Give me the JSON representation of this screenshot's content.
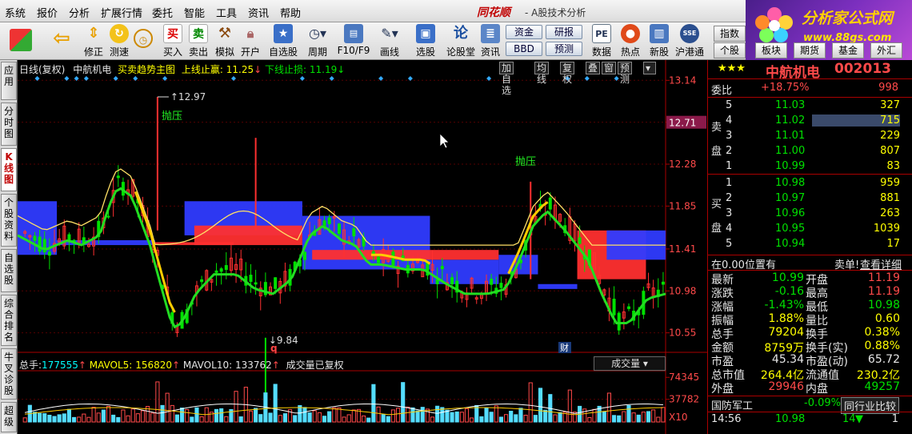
{
  "menu": [
    "系统",
    "报价",
    "分析",
    "扩展行情",
    "委托",
    "智能",
    "工具",
    "资讯",
    "帮助"
  ],
  "brand": "同花顺",
  "brand_sub": "- A股技术分析",
  "logo": {
    "title": "分析家公式网",
    "url": "www.88gs.com"
  },
  "toolbar": [
    {
      "label": "修正",
      "icon": "up-down-arrows-icon"
    },
    {
      "label": "测速",
      "icon": "speed-icon"
    },
    {
      "label": "买入",
      "icon": "buy-icon",
      "glyph": "买"
    },
    {
      "label": "卖出",
      "icon": "sell-icon",
      "glyph": "卖"
    },
    {
      "label": "模拟",
      "icon": "hammer-icon"
    },
    {
      "label": "开户",
      "icon": "lock-icon"
    },
    {
      "label": "自选股",
      "icon": "star-icon"
    },
    {
      "label": "周期",
      "icon": "clock-icon"
    },
    {
      "label": "F10/F9",
      "icon": "document-icon"
    },
    {
      "label": "画线",
      "icon": "pen-icon"
    },
    {
      "label": "选股",
      "icon": "monitor-icon"
    },
    {
      "label": "论股堂",
      "icon": "discuss-icon"
    },
    {
      "label": "资讯",
      "icon": "news-icon"
    },
    {
      "label": "数据",
      "icon": "pe-icon",
      "glyph": "PE"
    },
    {
      "label": "热点",
      "icon": "hot-icon"
    },
    {
      "label": "新股",
      "icon": "new-stock-icon"
    },
    {
      "label": "沪港通",
      "icon": "sse-hkex-icon"
    }
  ],
  "toolbar_buttons": [
    "资金",
    "研报",
    "BBD",
    "预测"
  ],
  "right_tabs": [
    "指数",
    "个股",
    "板块",
    "期货",
    "基金",
    "外汇"
  ],
  "left_tabs": [
    {
      "label": "应用",
      "active": false
    },
    {
      "label": "分时图",
      "active": false
    },
    {
      "label": "K线图",
      "active": true
    },
    {
      "label": "个股资料",
      "active": false
    },
    {
      "label": "自选股",
      "active": false
    },
    {
      "label": "综合排名",
      "active": false
    },
    {
      "label": "牛叉诊股",
      "active": false
    },
    {
      "label": "超级",
      "active": false
    }
  ],
  "chart_header": {
    "period": "日线(复权)",
    "name": "中航机电",
    "indicator": "买卖趋势主图",
    "upper_label": "上线止赢:",
    "upper_value": "11.25",
    "lower_label": "下线止损:",
    "lower_value": "11.19",
    "buttons": [
      "加自选",
      "均线",
      "复权",
      "叠",
      "窗",
      "预测"
    ]
  },
  "price_axis": [
    "13.14",
    "12.71",
    "12.28",
    "11.85",
    "11.41",
    "10.98",
    "10.55"
  ],
  "current_price_tag": "12.71",
  "annotations": {
    "high": "12.97",
    "low": "9.84",
    "pressure1": "抛压",
    "pressure2": "抛压",
    "q_marker": "q",
    "cai_marker": "财"
  },
  "volume_header": {
    "total_label": "总手:",
    "total": "177555",
    "mavol5_label": "MAVOL5:",
    "mavol5": "156820",
    "mavol10_label": "MAVOL10:",
    "mavol10": "133762",
    "note": "成交量已复权",
    "dropdown": "成交量"
  },
  "volume_axis": [
    "74345",
    "37782",
    "X10"
  ],
  "quote": {
    "stars": "★★★",
    "name": "中航机电",
    "code": "002013",
    "weibi_label": "委比",
    "weibi": "+18.75%",
    "weicha": "998",
    "sell_label": "卖盘",
    "buy_label": "买盘",
    "asks": [
      {
        "lvl": "5",
        "price": "11.03",
        "vol": "327"
      },
      {
        "lvl": "4",
        "price": "11.02",
        "vol": "715"
      },
      {
        "lvl": "3",
        "price": "11.01",
        "vol": "229"
      },
      {
        "lvl": "2",
        "price": "11.00",
        "vol": "807"
      },
      {
        "lvl": "1",
        "price": "10.99",
        "vol": "83"
      }
    ],
    "bids": [
      {
        "lvl": "1",
        "price": "10.98",
        "vol": "959"
      },
      {
        "lvl": "2",
        "price": "10.97",
        "vol": "881"
      },
      {
        "lvl": "3",
        "price": "10.96",
        "vol": "263"
      },
      {
        "lvl": "4",
        "price": "10.95",
        "vol": "1039"
      },
      {
        "lvl": "5",
        "price": "10.94",
        "vol": "17"
      }
    ],
    "position_note": "在0.00位置有",
    "sell_single": "卖单!",
    "detail_link": "查看详细",
    "stats": [
      {
        "l1": "最新",
        "v1": "10.99",
        "c1": "green",
        "l2": "开盘",
        "v2": "11.19",
        "c2": "red"
      },
      {
        "l1": "涨跌",
        "v1": "-0.16",
        "c1": "green",
        "l2": "最高",
        "v2": "11.19",
        "c2": "red"
      },
      {
        "l1": "涨幅",
        "v1": "-1.43%",
        "c1": "green",
        "l2": "最低",
        "v2": "10.98",
        "c2": "green"
      },
      {
        "l1": "振幅",
        "v1": "1.88%",
        "c1": "yellow",
        "l2": "量比",
        "v2": "0.60",
        "c2": "yellow"
      },
      {
        "l1": "总手",
        "v1": "79204",
        "c1": "yellow",
        "l2": "换手",
        "v2": "0.38%",
        "c2": "yellow"
      },
      {
        "l1": "金额",
        "v1": "8759万",
        "c1": "yellow",
        "l2": "换手(实)",
        "v2": "0.88%",
        "c2": "yellow"
      },
      {
        "l1": "市盈",
        "v1": "45.34",
        "c1": "white",
        "l2": "市盈(动)",
        "v2": "65.72",
        "c2": "white"
      },
      {
        "l1": "总市值",
        "v1": "264.4亿",
        "c1": "yellow",
        "l2": "流通值",
        "v2": "230.2亿",
        "c2": "yellow"
      },
      {
        "l1": "外盘",
        "v1": "29946",
        "c1": "red",
        "l2": "内盘",
        "v2": "49257",
        "c2": "green"
      }
    ],
    "sector": "国防军工",
    "sector_change": "-0.09%",
    "compare_btn": "同行业比较",
    "tick_time": "14:56",
    "tick_price": "10.98",
    "tick_vol": "14",
    "tick_count": "1"
  },
  "colors": {
    "up": "#ff3030",
    "down": "#00e000",
    "blue_band": "#2f3bff",
    "red_band": "#ff2f2f",
    "yellow": "#ffcc00",
    "green_line": "#22dd22",
    "axis_red": "#aa0000",
    "vol_bar": "#55ddff"
  },
  "chart_data": {
    "type": "candlestick",
    "price_ticks": [
      13.14,
      12.71,
      12.28,
      11.85,
      11.41,
      10.98,
      10.55
    ],
    "ylim": [
      10.35,
      13.2
    ],
    "high_marker": 12.97,
    "low_marker": 9.84,
    "upper_stop": 11.25,
    "lower_stop": 11.19,
    "volume_ticks": [
      74345,
      37782
    ],
    "volume_last": 177555,
    "mavol5": 156820,
    "mavol10": 133762
  }
}
